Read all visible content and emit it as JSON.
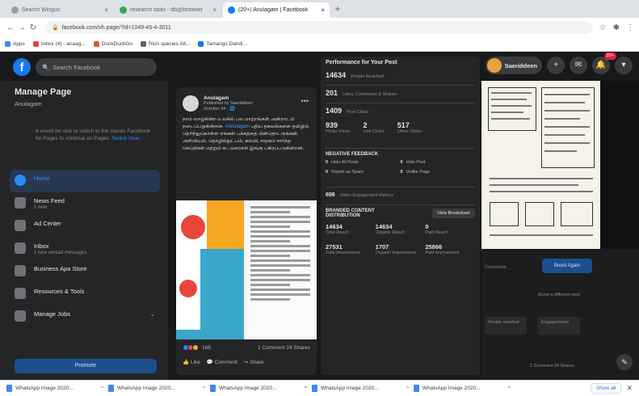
{
  "browser": {
    "tabs": [
      {
        "label": "Search Wingus",
        "active": false
      },
      {
        "label": "research tools - db@browser",
        "active": false
      },
      {
        "label": "(20+) Anulagam | Facebook",
        "active": true
      }
    ],
    "url": "facebook.com/vh.page/?id=1049-45-4-3011",
    "bookmarks": [
      "Apps",
      "Inbox (4) - anaag...",
      "DuckDuckGo",
      "Rich species Alt...",
      "Tamangs Dandi..."
    ]
  },
  "fb": {
    "search_placeholder": "Search Facebook",
    "profile_name": "Saeriddeen",
    "notif_badge": "20+"
  },
  "left_panel": {
    "title": "Manage Page",
    "subtitle": "Anulagam",
    "note": "It would be nice to switch to the classic Facebook for Pages to continue on Pages.",
    "note_link": "Switch Now",
    "items": [
      {
        "label": "Home",
        "sub": "",
        "active": true
      },
      {
        "label": "News Feed",
        "sub": "1 new",
        "active": false
      },
      {
        "label": "Ad Center",
        "sub": "",
        "active": false
      },
      {
        "label": "Inbox",
        "sub": "1 new unread messages",
        "active": false
      },
      {
        "label": "Business Apa Store",
        "sub": "",
        "active": false
      },
      {
        "label": "Resources & Tools",
        "sub": "",
        "active": false
      },
      {
        "label": "Manage Jobs",
        "sub": "",
        "active": false
      }
    ],
    "promote_label": "Promote"
  },
  "post": {
    "author": "Anulagam",
    "meta1": "Published by Saeriddeen",
    "meta2": "October 24 · 🌐",
    "text_a": "நாம் வாழ்கின்ற உலகில் பல மாற்றங்கள் அன்றாடம் நடைபெறுகின்றன.",
    "hashtag": "#Anulagam",
    "text_b": "புதிய தகவல்களை தமிழில் தெரிந்துகொள்ள எங்கள் பக்கத்தை பின்தொடருங்கள். அறிவியல், தொழில்நுட்பம், கல்வி, சமூகம் சார்ந்த செய்திகள் மற்றும் கட்டுரைகள் இங்கு பகிரப்படுகின்றன.",
    "reactions": "166",
    "comments_shares": "1 Comment 24 Shares",
    "actions": [
      "Like",
      "Comment",
      "Share"
    ]
  },
  "perf": {
    "title": "Performance for Your Post",
    "reach_n": "14634",
    "reach_l": "People Reached",
    "reactions_n": "201",
    "reactions_l": "Likes, Comments & Shares",
    "clicks_n": "1409",
    "clicks_l": "Post Clicks",
    "c3": [
      {
        "n": "939",
        "l": "Photo Views"
      },
      {
        "n": "2",
        "l": "Link Clicks"
      },
      {
        "n": "517",
        "l": "Other Clicks"
      }
    ],
    "negative_head": "NEGATIVE FEEDBACK",
    "negative": [
      {
        "n": "0",
        "l": "Hide All Posts"
      },
      {
        "n": "0",
        "l": "Hide Post"
      },
      {
        "n": "0",
        "l": "Report as Spam"
      },
      {
        "n": "0",
        "l": "Unlike Page"
      }
    ],
    "engagement_n": "696",
    "engagement_l": "Video Engagement Metrics",
    "dist_head": "BRANDED CONTENT DISTRIBUTION",
    "dist_btn": "View Breakdown",
    "dist": [
      {
        "n": "14634",
        "l": "Total Reach"
      },
      {
        "n": "14634",
        "l": "Organic Reach"
      },
      {
        "n": "0",
        "l": "Paid Reach"
      },
      {
        "n": "27531",
        "l": "Total Impressions"
      },
      {
        "n": "1707",
        "l": "Organic Impressions"
      },
      {
        "n": "25866",
        "l": "Paid Impressions"
      }
    ]
  },
  "right": {
    "boost_label": "Boost Again",
    "side_texts": [
      "Comments",
      "Boost a different post",
      "People reached",
      "Engagements"
    ],
    "footer": "1 Comment 24 Shares"
  },
  "downloads": {
    "items": [
      "WhatsApp Image 2020...",
      "WhatsApp Image 2020...",
      "WhatsApp Image 2020...",
      "WhatsApp Image 2020...",
      "WhatsApp Image 2020..."
    ],
    "show_all": "Show all"
  }
}
